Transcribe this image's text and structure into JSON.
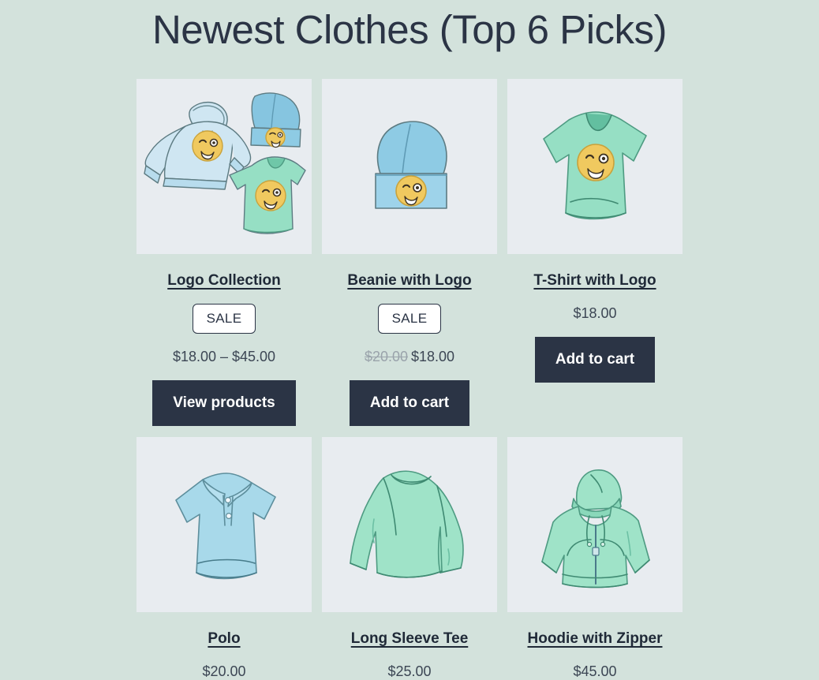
{
  "page": {
    "title": "Newest Clothes (Top 6 Picks)",
    "background_color": "#d3e2dc",
    "thumb_background_color": "#e8ecf0",
    "button_color": "#2b3445",
    "text_color": "#2b3445"
  },
  "products": [
    {
      "name": "Logo Collection",
      "image": "logo-collection-hoodie-beanie-tshirt",
      "badge": "SALE",
      "price": "$18.00 – $45.00",
      "old_price": "",
      "action_label": "View products"
    },
    {
      "name": "Beanie with Logo",
      "image": "blue-beanie-with-emoji-patch",
      "badge": "SALE",
      "price": "$18.00",
      "old_price": "$20.00",
      "action_label": "Add to cart"
    },
    {
      "name": "T-Shirt with Logo",
      "image": "green-vneck-tshirt-with-emoji-patch",
      "badge": "",
      "price": "$18.00",
      "old_price": "",
      "action_label": "Add to cart"
    },
    {
      "name": "Polo",
      "image": "blue-polo-shirt",
      "badge": "",
      "price": "$20.00",
      "old_price": "",
      "action_label": ""
    },
    {
      "name": "Long Sleeve Tee",
      "image": "mint-long-sleeve-tee",
      "badge": "",
      "price": "$25.00",
      "old_price": "",
      "action_label": ""
    },
    {
      "name": "Hoodie with Zipper",
      "image": "mint-zip-hoodie",
      "badge": "",
      "price": "$45.00",
      "old_price": "",
      "action_label": ""
    }
  ]
}
